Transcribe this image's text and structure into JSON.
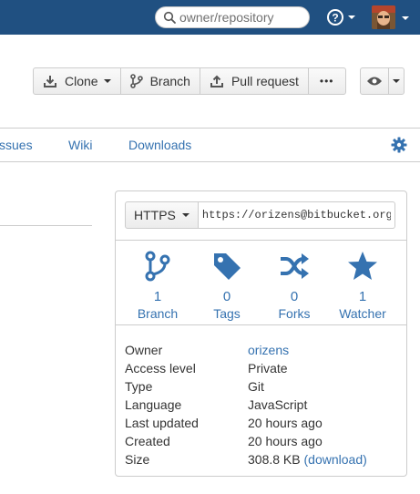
{
  "header": {
    "search_placeholder": "owner/repository",
    "help_icon": "question-circle-icon",
    "avatar_alt": "user-avatar"
  },
  "actions": {
    "clone_label": "Clone",
    "branch_label": "Branch",
    "pull_request_label": "Pull request",
    "more_label": "•••"
  },
  "tabs": {
    "issues_label": "ssues",
    "wiki_label": "Wiki",
    "downloads_label": "Downloads"
  },
  "clone_panel": {
    "protocol": "HTTPS",
    "url": "https://orizens@bitbucket.org/"
  },
  "stats": [
    {
      "count": "1",
      "label": "Branch",
      "icon": "branch-icon"
    },
    {
      "count": "0",
      "label": "Tags",
      "icon": "tag-icon"
    },
    {
      "count": "0",
      "label": "Forks",
      "icon": "fork-icon"
    },
    {
      "count": "1",
      "label": "Watcher",
      "icon": "star-icon"
    }
  ],
  "details": {
    "owner_key": "Owner",
    "owner_value": "orizens",
    "access_key": "Access level",
    "access_value": "Private",
    "type_key": "Type",
    "type_value": "Git",
    "language_key": "Language",
    "language_value": "JavaScript",
    "updated_key": "Last updated",
    "updated_value": "20 hours ago",
    "created_key": "Created",
    "created_value": "20 hours ago",
    "size_key": "Size",
    "size_value": "308.8 KB",
    "size_link": "(download)"
  },
  "colors": {
    "topbar": "#205081",
    "link": "#3572b0",
    "border": "#cccccc"
  }
}
